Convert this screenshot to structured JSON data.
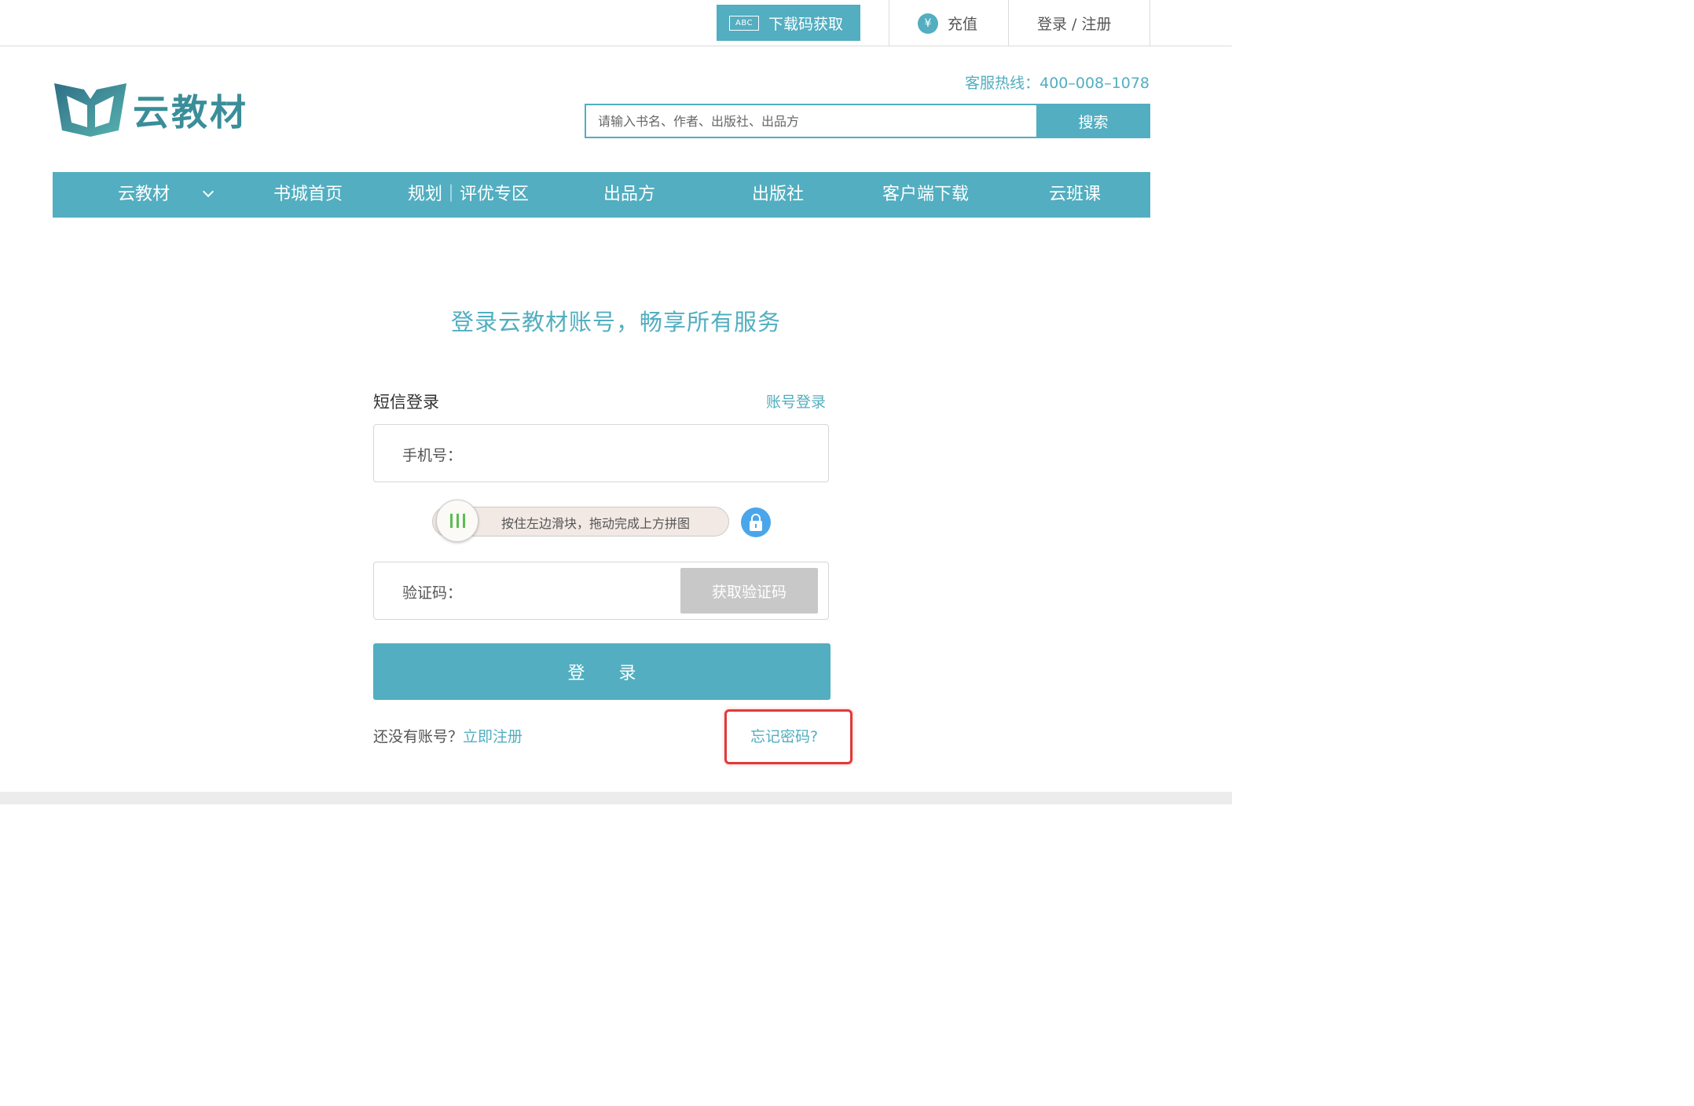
{
  "topbar": {
    "download_code": {
      "badge": "ABC",
      "label": "下载码获取"
    },
    "recharge": {
      "icon": "¥",
      "label": "充值"
    },
    "login_register": "登录 / 注册"
  },
  "header": {
    "logo_text": "云教材",
    "hotline": "客服热线：400–008–1078",
    "search": {
      "placeholder": "请输入书名、作者、出版社、出品方",
      "button": "搜索"
    }
  },
  "nav": {
    "items": [
      {
        "label": "云教材",
        "has_dropdown": true
      },
      {
        "label": "书城首页"
      },
      {
        "label": "规划｜评优专区"
      },
      {
        "label": "出品方"
      },
      {
        "label": "出版社"
      },
      {
        "label": "客户端下载"
      },
      {
        "label": "云班课"
      }
    ]
  },
  "main": {
    "headline": "登录云教材账号，畅享所有服务",
    "form": {
      "title": "短信登录",
      "switch_link": "账号登录",
      "phone_label": "手机号：",
      "slider_text": "按住左边滑块，拖动完成上方拼图",
      "code_label": "验证码：",
      "get_code": "获取验证码",
      "submit": "登 录",
      "no_account": "还没有账号？",
      "register_link": "立即注册",
      "forgot": "忘记密码?"
    }
  },
  "colors": {
    "accent": "#52aec0",
    "highlight": "#e03a3a",
    "lock": "#4aa6ea",
    "disabled": "#c8c8c8"
  }
}
